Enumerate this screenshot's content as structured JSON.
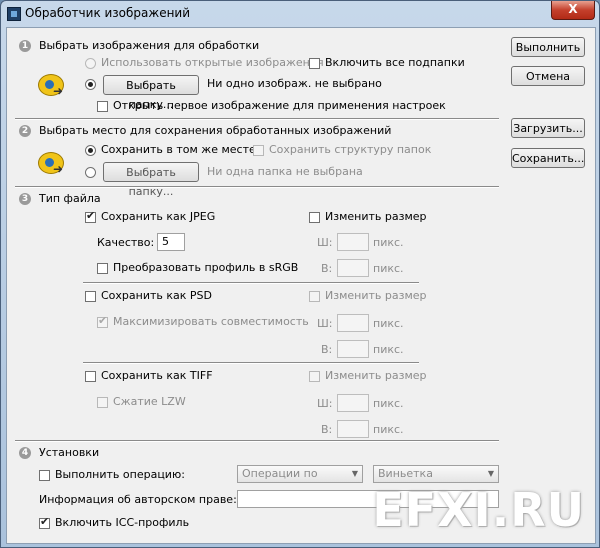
{
  "window": {
    "title": "Обработчик изображений",
    "close_glyph": "X"
  },
  "buttons": {
    "run": "Выполнить",
    "cancel": "Отмена",
    "load": "Загрузить...",
    "save": "Сохранить..."
  },
  "section1": {
    "number": "1",
    "header": "Выбрать изображения для обработки",
    "use_open": "Использовать открытые изображения",
    "include_subfolders": "Включить все подпапки",
    "choose_folder": "Выбрать папку...",
    "status": "Ни одно изображ. не выбрано",
    "open_first": "Открыть первое изображение для применения настроек"
  },
  "section2": {
    "number": "2",
    "header": "Выбрать место для сохранения обработанных изображений",
    "same_place": "Сохранить в том же месте",
    "keep_structure": "Сохранить структуру папок",
    "choose_folder": "Выбрать папку...",
    "status": "Ни одна папка не выбрана"
  },
  "section3": {
    "number": "3",
    "header": "Тип файла",
    "jpeg": {
      "save_as": "Сохранить как JPEG",
      "resize": "Изменить размер",
      "quality_label": "Качество:",
      "quality_value": "5",
      "w_label": "Ш:",
      "h_label": "В:",
      "unit": "пикс.",
      "convert": "Преобразовать профиль в sRGB"
    },
    "psd": {
      "save_as": "Сохранить как PSD",
      "resize": "Изменить размер",
      "maximize": "Максимизировать совместимость",
      "w_label": "Ш:",
      "h_label": "В:",
      "unit": "пикс."
    },
    "tiff": {
      "save_as": "Сохранить как TIFF",
      "resize": "Изменить размер",
      "lzw": "Сжатие LZW",
      "w_label": "Ш:",
      "h_label": "В:",
      "unit": "пикс."
    }
  },
  "section4": {
    "number": "4",
    "header": "Установки",
    "run_action": "Выполнить операцию:",
    "action_set": "Операции по умол...",
    "action": "Виньетка (выделен...",
    "copyright_label": "Информация об авторском праве:",
    "copyright_value": "",
    "icc": "Включить ICC-профиль"
  },
  "watermark": "EFXI.RU",
  "icons": {
    "processor": "photoshop-eye-icon",
    "close": "close-icon",
    "dropdown": "chevron-down-icon"
  },
  "colors": {
    "title_bar": "#aac2dc",
    "close_button": "#c4402c",
    "panel": "#f0f0f0"
  }
}
